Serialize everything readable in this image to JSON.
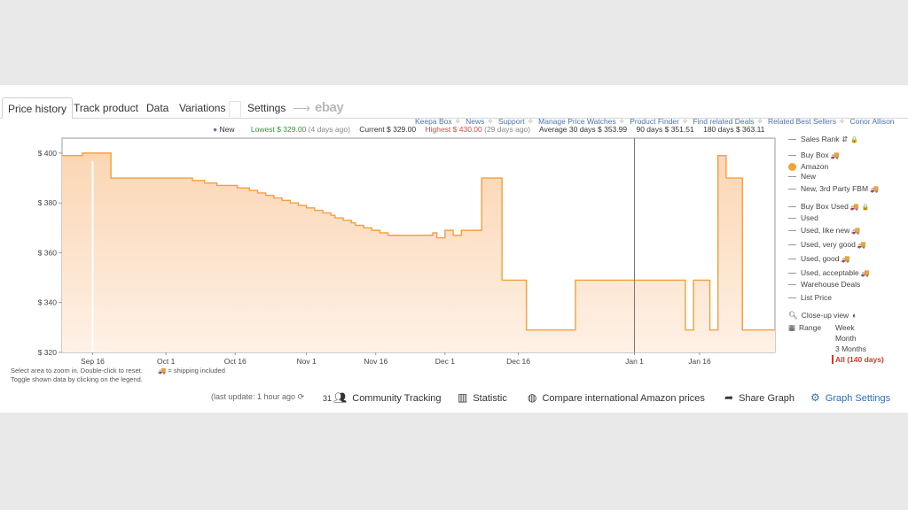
{
  "tabs": [
    "Price history",
    "Track product",
    "Data",
    "Variations",
    "Settings",
    "ebay"
  ],
  "links": [
    "Keepa Box",
    "News",
    "Support",
    "Manage Price Watches",
    "Product Finder",
    "Find related Deals",
    "Related Best Sellers",
    "Conor Allison"
  ],
  "stats": {
    "new_label": "New",
    "lowest": "Lowest $ 329.00",
    "lowest_ago": "(4 days ago)",
    "current": "Current $ 329.00",
    "highest": "Highest $ 430.00",
    "highest_ago": "(29 days ago)",
    "avg30": "Average 30 days $ 353.99",
    "avg90": "90 days $ 351.51",
    "avg180": "180 days $ 363.11"
  },
  "legend": {
    "items": [
      "Sales Rank",
      "Buy Box",
      "Amazon",
      "New",
      "New, 3rd Party FBM",
      "Buy Box Used",
      "Used",
      "Used, like new",
      "Used, very good",
      "Used, good",
      "Used, acceptable",
      "Warehouse Deals",
      "List Price"
    ],
    "closeup": "Close-up view",
    "range_label": "Range",
    "ranges": [
      "Week",
      "Month",
      "3 Months",
      "All (140 days)"
    ],
    "colors": {
      "amazon": "#f6a03a",
      "selected_range": "#d23a2a"
    }
  },
  "notes": {
    "zoom": "Select area to zoom in. Double-click to reset.",
    "toggle": "Toggle shown data by clicking on the legend.",
    "shipping": "= shipping included",
    "last_update": "(last update: 1 hour ago"
  },
  "actions": {
    "community_count": "31",
    "community": "Community Tracking",
    "statistic": "Statistic",
    "compare": "Compare international Amazon prices",
    "share": "Share Graph",
    "settings": "Graph Settings"
  },
  "chart_data": {
    "type": "area",
    "series": [
      {
        "name": "Amazon",
        "color": "#f6a03a",
        "x_days": [
          0,
          5,
          12,
          30,
          32,
          35,
          38,
          41,
          43,
          44,
          46,
          48,
          50,
          52,
          54,
          56,
          58,
          60,
          62,
          64,
          66,
          67,
          69,
          71,
          72,
          74,
          76,
          78,
          80,
          83,
          86,
          89,
          91,
          92,
          94,
          96,
          98,
          100,
          103,
          108,
          114,
          126,
          140,
          143,
          153,
          155,
          159,
          161,
          163,
          165,
          167,
          168,
          175
        ],
        "values": [
          399,
          400,
          390,
          390,
          389,
          388,
          387,
          387,
          386,
          386,
          385,
          384,
          383,
          382,
          381,
          380,
          379,
          378,
          377,
          376,
          375,
          374,
          373,
          372,
          371,
          370,
          369,
          368,
          367,
          367,
          367,
          367,
          368,
          366,
          369,
          367,
          369,
          369,
          390,
          349,
          329,
          349,
          349,
          349,
          329,
          349,
          329,
          399,
          390,
          390,
          329,
          329,
          329
        ]
      }
    ],
    "y_ticks": [
      "$ 400",
      "$ 380",
      "$ 360",
      "$ 340",
      "$ 320"
    ],
    "x_ticks": [
      "Sep 16",
      "Oct 1",
      "Oct 16",
      "Nov 1",
      "Nov 16",
      "Dec 1",
      "Dec 16",
      "Jan 1",
      "Jan 16"
    ],
    "ylim": [
      320,
      406
    ],
    "xlim_days": [
      0,
      175
    ],
    "grid": false,
    "legend_position": "right"
  }
}
